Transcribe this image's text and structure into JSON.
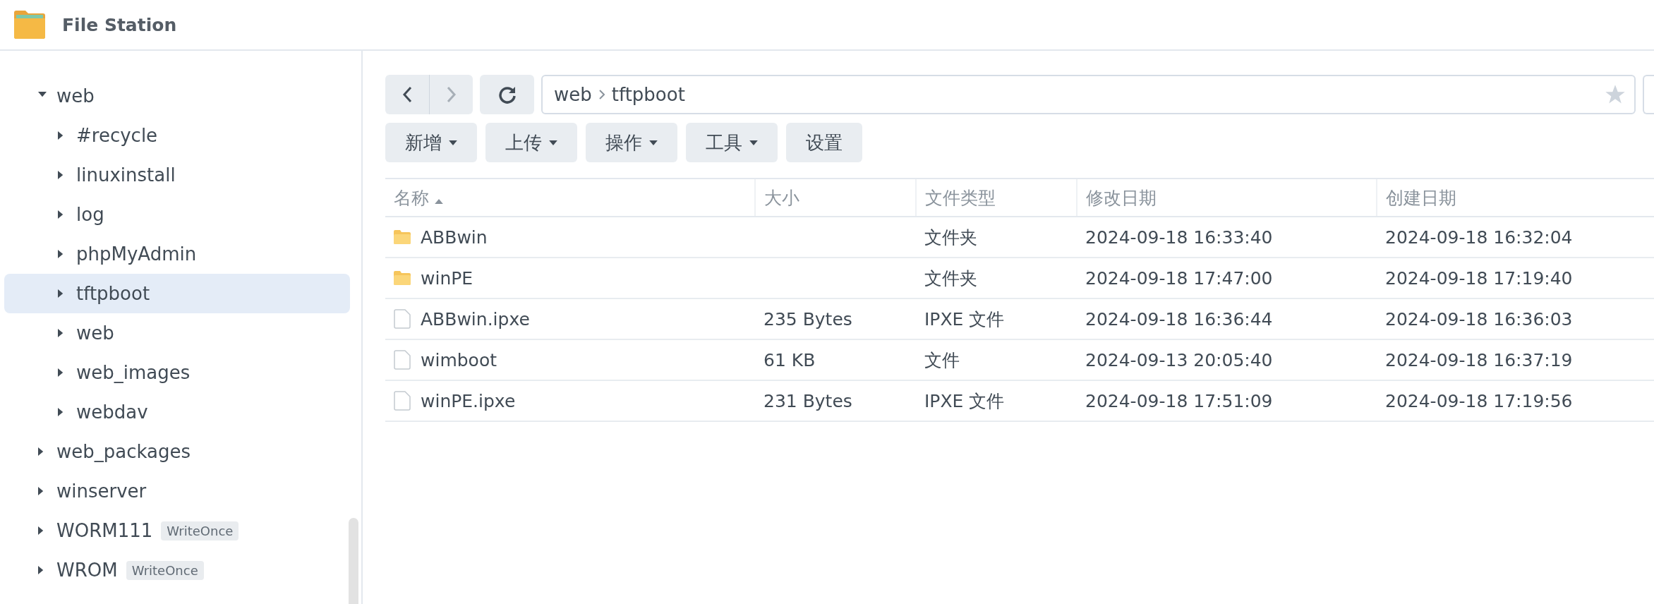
{
  "window": {
    "title": "File Station"
  },
  "sidebar": {
    "items": [
      {
        "label": "web",
        "expanded": true,
        "selected": false,
        "children": [
          {
            "label": "#recycle",
            "expanded": false,
            "selected": false
          },
          {
            "label": "linuxinstall",
            "expanded": false,
            "selected": false
          },
          {
            "label": "log",
            "expanded": false,
            "selected": false
          },
          {
            "label": "phpMyAdmin",
            "expanded": false,
            "selected": false
          },
          {
            "label": "tftpboot",
            "expanded": false,
            "selected": true
          },
          {
            "label": "web",
            "expanded": false,
            "selected": false
          },
          {
            "label": "web_images",
            "expanded": false,
            "selected": false
          },
          {
            "label": "webdav",
            "expanded": false,
            "selected": false
          }
        ]
      },
      {
        "label": "web_packages",
        "expanded": false,
        "selected": false
      },
      {
        "label": "winserver",
        "expanded": false,
        "selected": false
      },
      {
        "label": "WORM111",
        "expanded": false,
        "selected": false,
        "badge": "WriteOnce"
      },
      {
        "label": "WROM",
        "expanded": false,
        "selected": false,
        "badge": "WriteOnce"
      }
    ]
  },
  "path": {
    "back_disabled": false,
    "forward_disabled": true,
    "segments": [
      "web",
      "tftpboot"
    ]
  },
  "toolbar": [
    {
      "label": "新增",
      "dropdown": true
    },
    {
      "label": "上传",
      "dropdown": true
    },
    {
      "label": "操作",
      "dropdown": true
    },
    {
      "label": "工具",
      "dropdown": true
    },
    {
      "label": "设置",
      "dropdown": false
    }
  ],
  "table": {
    "columns": [
      {
        "label": "名称",
        "sorted": true
      },
      {
        "label": "大小",
        "sorted": false
      },
      {
        "label": "文件类型",
        "sorted": false
      },
      {
        "label": "修改日期",
        "sorted": false
      },
      {
        "label": "创建日期",
        "sorted": false
      }
    ],
    "rows": [
      {
        "kind": "folder",
        "name": "ABBwin",
        "size": "",
        "type": "文件夹",
        "modified": "2024-09-18 16:33:40",
        "created": "2024-09-18 16:32:04"
      },
      {
        "kind": "folder",
        "name": "winPE",
        "size": "",
        "type": "文件夹",
        "modified": "2024-09-18 17:47:00",
        "created": "2024-09-18 17:19:40"
      },
      {
        "kind": "file",
        "name": "ABBwin.ipxe",
        "size": "235 Bytes",
        "type": "IPXE 文件",
        "modified": "2024-09-18 16:36:44",
        "created": "2024-09-18 16:36:03"
      },
      {
        "kind": "file",
        "name": "wimboot",
        "size": "61 KB",
        "type": "文件",
        "modified": "2024-09-13 20:05:40",
        "created": "2024-09-18 16:37:19"
      },
      {
        "kind": "file",
        "name": "winPE.ipxe",
        "size": "231 Bytes",
        "type": "IPXE 文件",
        "modified": "2024-09-18 17:51:09",
        "created": "2024-09-18 17:19:56"
      }
    ]
  }
}
